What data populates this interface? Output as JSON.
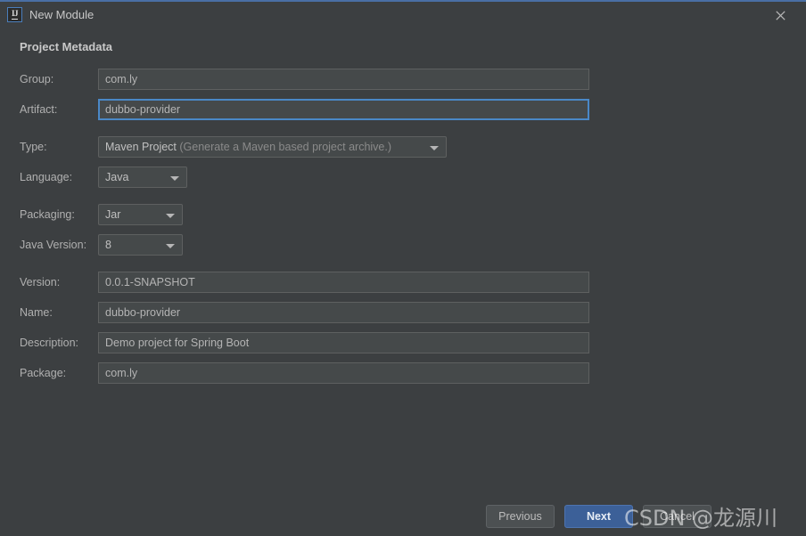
{
  "window": {
    "title": "New Module",
    "app_icon": "intellij-idea-icon",
    "close_icon": "close-icon",
    "accent_color": "#4a6fa5"
  },
  "section": {
    "title": "Project Metadata"
  },
  "form": {
    "group": {
      "label": "Group:",
      "value": "com.ly"
    },
    "artifact": {
      "label": "Artifact:",
      "value": "dubbo-provider",
      "focused": true,
      "focus_color": "#4a88c7"
    },
    "type": {
      "label": "Type:",
      "value": "Maven Project",
      "hint": "(Generate a Maven based project archive.)"
    },
    "language": {
      "label": "Language:",
      "value": "Java"
    },
    "packaging": {
      "label": "Packaging:",
      "value": "Jar"
    },
    "java_version": {
      "label": "Java Version:",
      "value": "8"
    },
    "version": {
      "label": "Version:",
      "value": "0.0.1-SNAPSHOT"
    },
    "name": {
      "label": "Name:",
      "value": "dubbo-provider"
    },
    "description": {
      "label": "Description:",
      "value": "Demo project for Spring Boot"
    },
    "package": {
      "label": "Package:",
      "value": "com.ly"
    }
  },
  "footer": {
    "previous_label": "Previous",
    "next_label": "Next",
    "cancel_label": "Cancel",
    "primary_color": "#3c6098"
  },
  "watermark": {
    "text": "CSDN @龙源川"
  }
}
